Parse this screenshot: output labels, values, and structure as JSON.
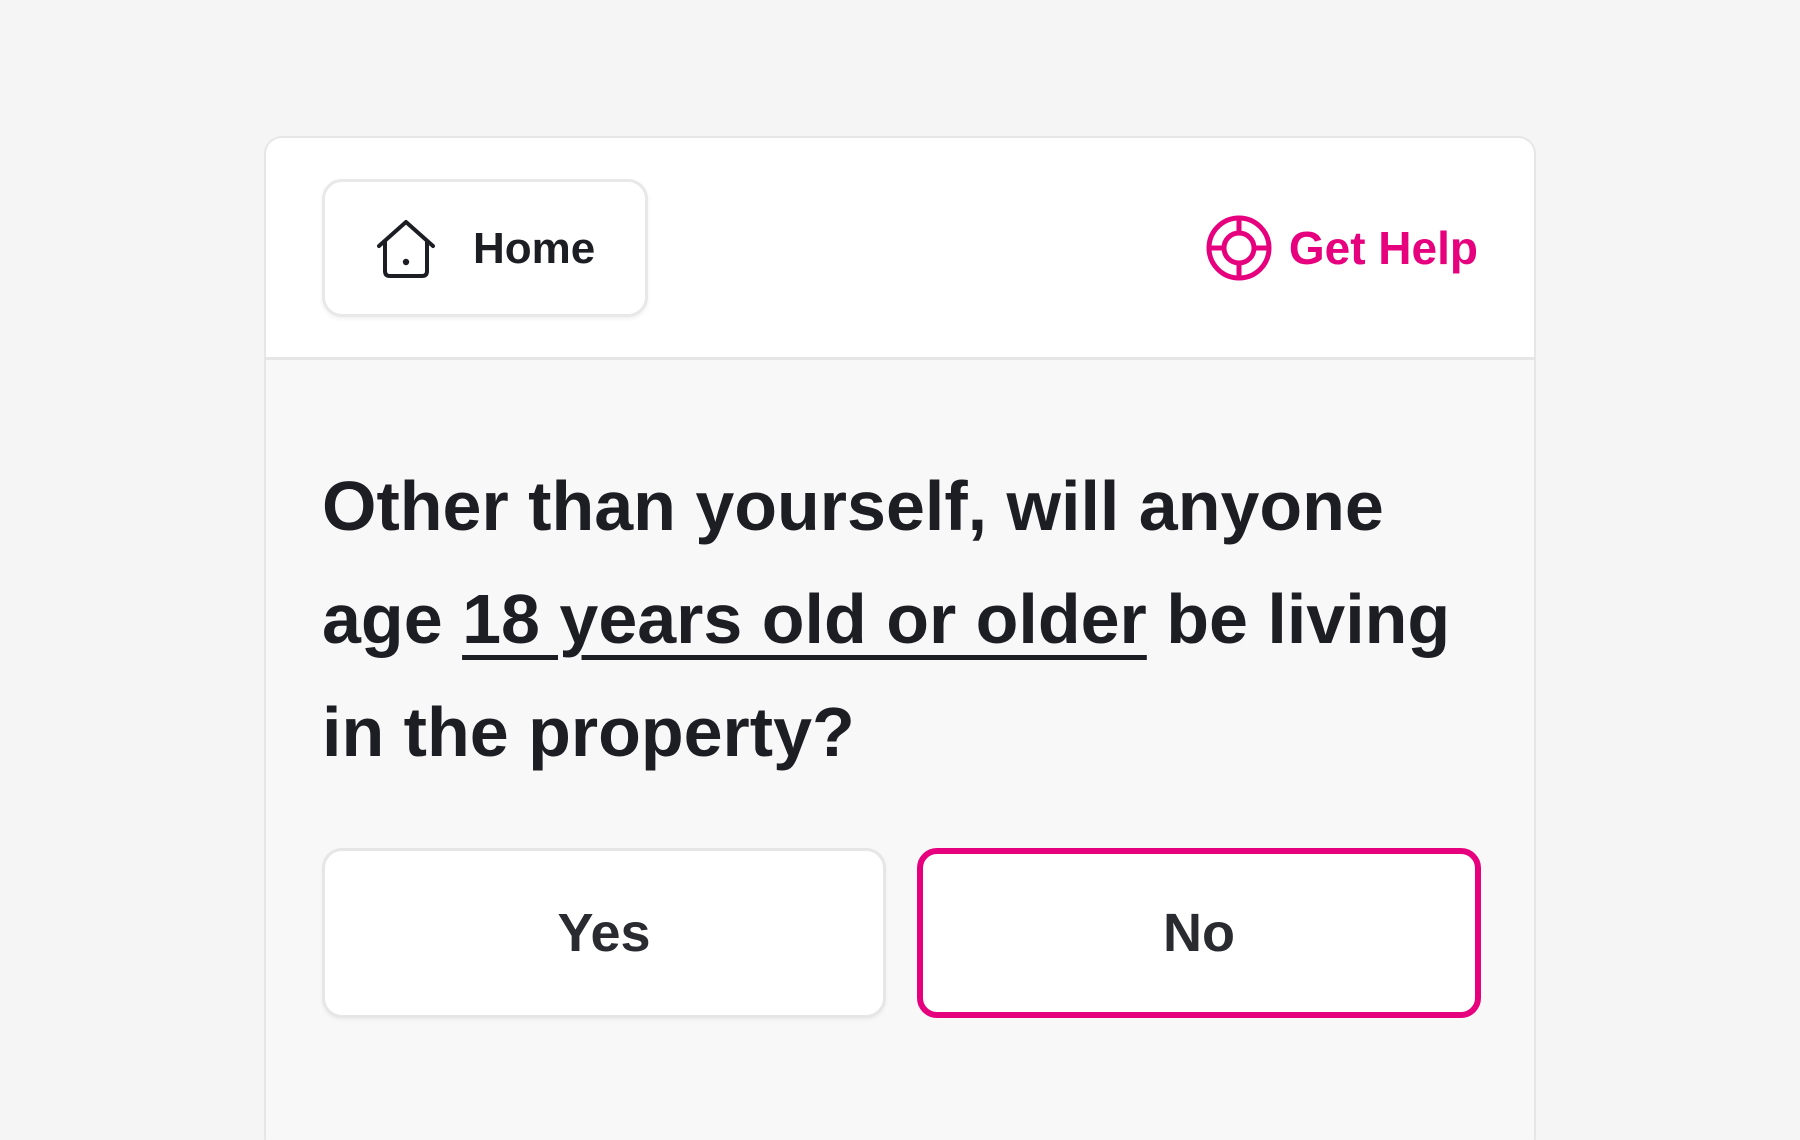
{
  "header": {
    "home_label": "Home",
    "home_icon": "home-icon",
    "help_label": "Get Help",
    "help_icon": "lifebuoy-icon"
  },
  "question": {
    "part1": "Other than yourself, will anyone age ",
    "emphasis": "18 years old or older",
    "part2": " be living in the property?"
  },
  "options": [
    {
      "label": "Yes",
      "selected": false
    },
    {
      "label": "No",
      "selected": true
    }
  ],
  "colors": {
    "accent": "#e6007e",
    "text": "#1d1e24",
    "page_bg": "#f5f5f5",
    "card_bg": "#f9f8f9",
    "border": "#e6e6e6"
  }
}
